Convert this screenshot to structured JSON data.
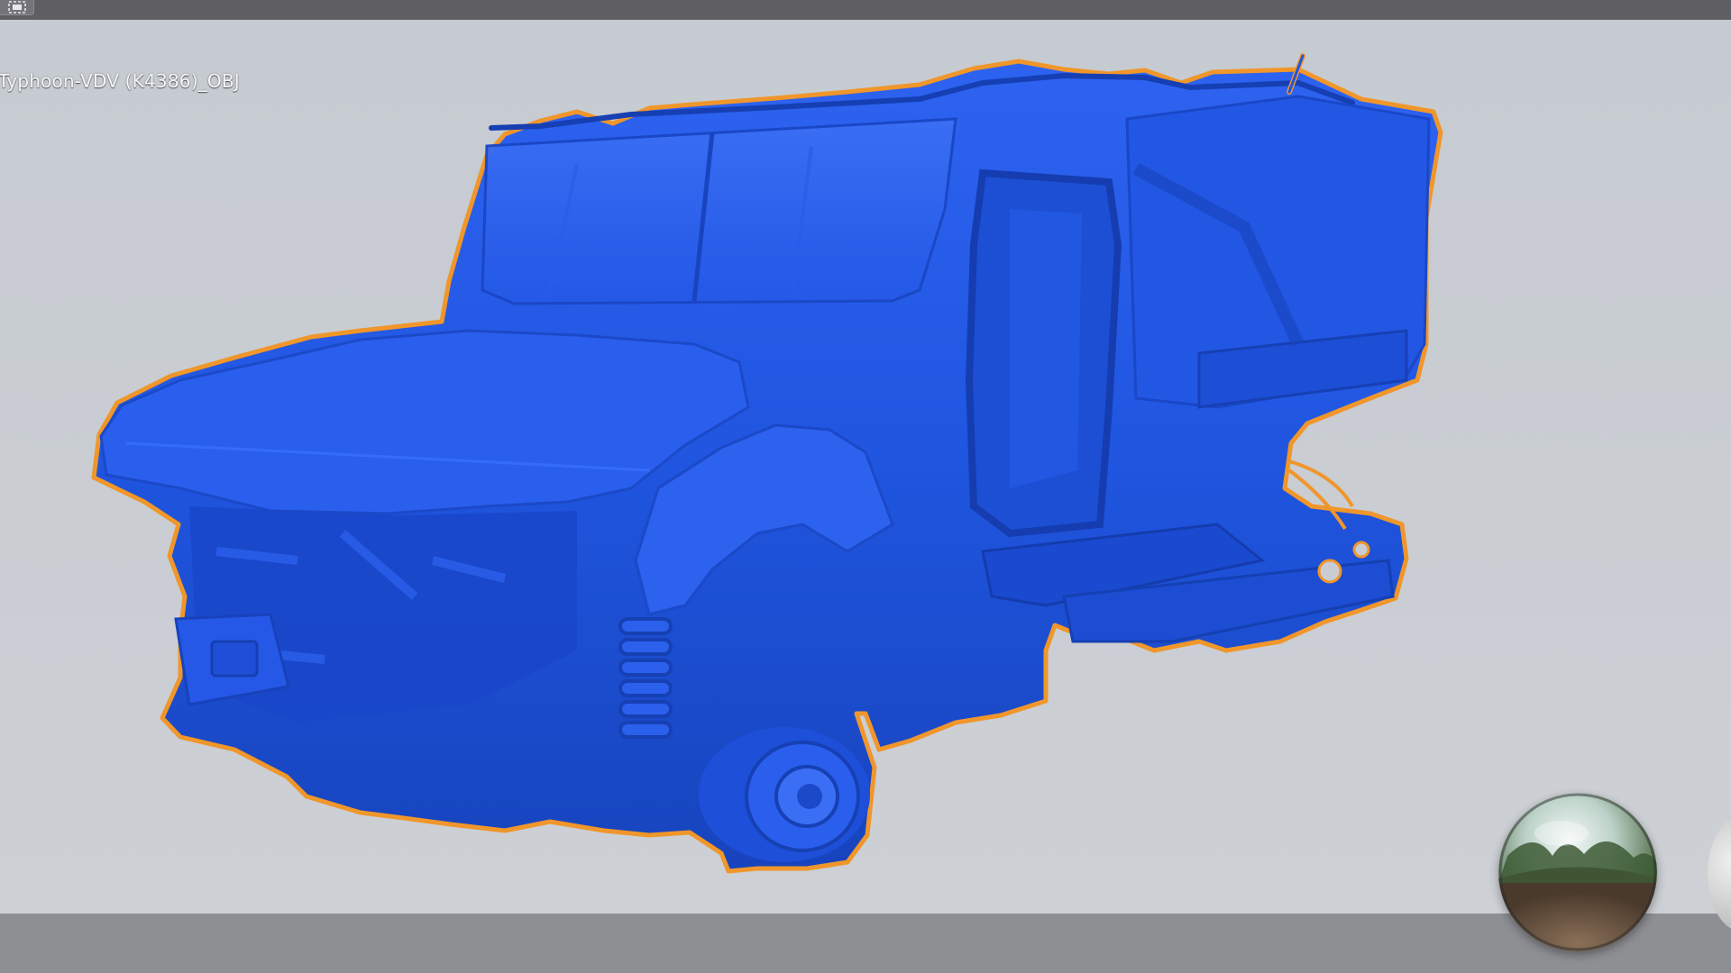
{
  "top_bar": {
    "corner_icon": "frame-icon"
  },
  "viewport": {
    "model_name": "Typhoon-VDV (K4386)_OBJ",
    "model_color": "#1f56e0",
    "selection_outline_color": "#f0962a",
    "background_color": "#c9cdd3"
  },
  "environment": {
    "preview_icon": "environment-sphere-icon"
  }
}
